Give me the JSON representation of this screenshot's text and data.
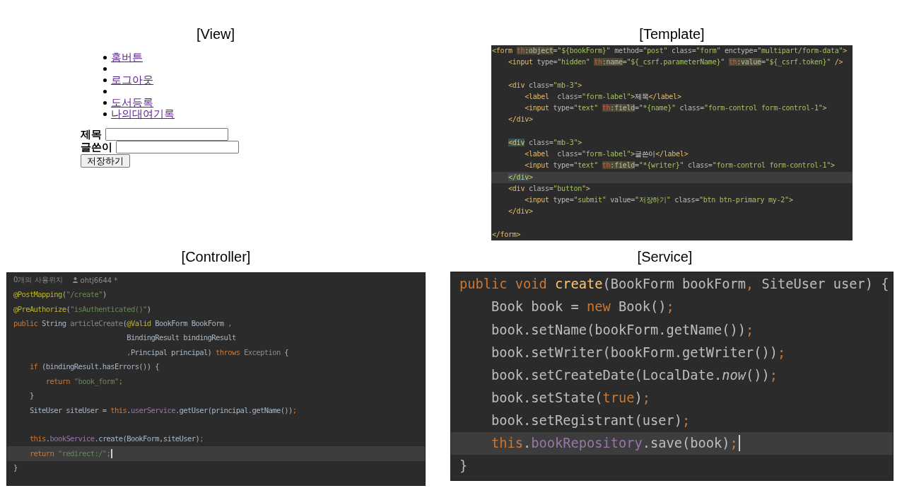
{
  "view": {
    "title": "[View]",
    "nav_items": [
      {
        "kind": "link",
        "label": "홈버튼"
      },
      {
        "kind": "empty"
      },
      {
        "kind": "link",
        "label": "로그아웃"
      },
      {
        "kind": "empty"
      },
      {
        "kind": "link",
        "label": "도서등록"
      },
      {
        "kind": "link",
        "label": "나의대여기록"
      }
    ],
    "form": {
      "fields": [
        {
          "label": "제목"
        },
        {
          "label": "글쓴이"
        }
      ],
      "submit": "저장하기"
    }
  },
  "template": {
    "title": "[Template]",
    "caret": false,
    "lines": [
      {
        "kind": "code",
        "current": false,
        "tokens": [
          {
            "text": "<form ",
            "kind": "tag"
          },
          {
            "text": "th",
            "kind": "th-prefix"
          },
          {
            "text": ":object",
            "kind": "th-attr"
          },
          {
            "text": "=",
            "kind": "attr"
          },
          {
            "text": "\"${bookForm}\"",
            "kind": "value"
          },
          {
            "text": " method=",
            "kind": "attr"
          },
          {
            "text": "\"post\"",
            "kind": "value"
          },
          {
            "text": " class=",
            "kind": "attr"
          },
          {
            "text": "\"form\"",
            "kind": "value"
          },
          {
            "text": " enctype=",
            "kind": "attr"
          },
          {
            "text": "\"multipart/form-data\"",
            "kind": "value"
          },
          {
            "text": ">",
            "kind": "tag"
          }
        ],
        "children": [
          {
            "kind": "code",
            "current": false,
            "tokens": [
              {
                "text": "<input",
                "kind": "tag"
              },
              {
                "text": " type=",
                "kind": "attr"
              },
              {
                "text": "\"hidden\" ",
                "kind": "value"
              },
              {
                "text": "th",
                "kind": "th-prefix"
              },
              {
                "text": ":name",
                "kind": "th-attr"
              },
              {
                "text": "=",
                "kind": "attr"
              },
              {
                "text": "\"${_csrf.parameterName}\" ",
                "kind": "value"
              },
              {
                "text": "th",
                "kind": "th-prefix"
              },
              {
                "text": ":value",
                "kind": "th-attr"
              },
              {
                "text": "=",
                "kind": "attr"
              },
              {
                "text": "\"${_csrf.token}\"",
                "kind": "value"
              },
              {
                "text": " />",
                "kind": "tag"
              }
            ]
          },
          {
            "kind": "blank",
            "current": false
          },
          {
            "kind": "code",
            "current": false,
            "tokens": [
              {
                "text": "<div",
                "kind": "tag"
              },
              {
                "text": " class=",
                "kind": "attr"
              },
              {
                "text": "\"mb-3\"",
                "kind": "value"
              },
              {
                "text": ">",
                "kind": "tag"
              }
            ],
            "children": [
              {
                "kind": "code",
                "current": false,
                "tokens": [
                  {
                    "text": "<label",
                    "kind": "tag"
                  },
                  {
                    "text": "  class=",
                    "kind": "attr"
                  },
                  {
                    "text": "\"form-label\"",
                    "kind": "value"
                  },
                  {
                    "text": ">",
                    "kind": "tag"
                  },
                  {
                    "text": "제목",
                    "kind": "text"
                  },
                  {
                    "text": "</label>",
                    "kind": "tag"
                  }
                ]
              },
              {
                "kind": "code",
                "current": false,
                "tokens": [
                  {
                    "text": "<input",
                    "kind": "tag"
                  },
                  {
                    "text": " type=",
                    "kind": "attr"
                  },
                  {
                    "text": "\"text\" ",
                    "kind": "value"
                  },
                  {
                    "text": "th",
                    "kind": "th-prefix"
                  },
                  {
                    "text": ":field",
                    "kind": "th-attr"
                  },
                  {
                    "text": "=",
                    "kind": "attr"
                  },
                  {
                    "text": "\"*{name}\"",
                    "kind": "value"
                  },
                  {
                    "text": " class=",
                    "kind": "attr"
                  },
                  {
                    "text": "\"form-control form-control-1\"",
                    "kind": "value"
                  },
                  {
                    "text": ">",
                    "kind": "tag"
                  }
                ]
              }
            ]
          },
          {
            "kind": "code",
            "current": false,
            "tokens": [
              {
                "text": "</div>",
                "kind": "tag"
              }
            ]
          },
          {
            "kind": "blank",
            "current": false
          },
          {
            "kind": "code",
            "current": false,
            "tokens": [
              {
                "text": "<div",
                "kind": "tag-matched"
              },
              {
                "text": " class=",
                "kind": "attr"
              },
              {
                "text": "\"mb-3\"",
                "kind": "value"
              },
              {
                "text": ">",
                "kind": "tag"
              }
            ],
            "children": [
              {
                "kind": "code",
                "current": false,
                "tokens": [
                  {
                    "text": "<label",
                    "kind": "tag"
                  },
                  {
                    "text": "  class=",
                    "kind": "attr"
                  },
                  {
                    "text": "\"form-label\"",
                    "kind": "value"
                  },
                  {
                    "text": ">",
                    "kind": "tag"
                  },
                  {
                    "text": "글쓴이",
                    "kind": "text"
                  },
                  {
                    "text": "</label>",
                    "kind": "tag"
                  }
                ]
              },
              {
                "kind": "code",
                "current": false,
                "tokens": [
                  {
                    "text": "<input",
                    "kind": "tag"
                  },
                  {
                    "text": " type=",
                    "kind": "attr"
                  },
                  {
                    "text": "\"text\" ",
                    "kind": "value"
                  },
                  {
                    "text": "th",
                    "kind": "th-prefix"
                  },
                  {
                    "text": ":field",
                    "kind": "th-attr"
                  },
                  {
                    "text": "=",
                    "kind": "attr"
                  },
                  {
                    "text": "\"*{writer}\"",
                    "kind": "value"
                  },
                  {
                    "text": " class=",
                    "kind": "attr"
                  },
                  {
                    "text": "\"form-control form-control-1\"",
                    "kind": "value"
                  },
                  {
                    "text": ">",
                    "kind": "tag"
                  }
                ]
              }
            ]
          },
          {
            "kind": "code",
            "current": true,
            "tokens": [
              {
                "text": "</div",
                "kind": "tag-matched"
              },
              {
                "text": ">",
                "kind": "tag"
              }
            ]
          },
          {
            "kind": "code",
            "current": false,
            "tokens": [
              {
                "text": "<div",
                "kind": "tag"
              },
              {
                "text": " class=",
                "kind": "attr"
              },
              {
                "text": "\"button\"",
                "kind": "value"
              },
              {
                "text": ">",
                "kind": "tag"
              }
            ],
            "children": [
              {
                "kind": "code",
                "current": false,
                "tokens": [
                  {
                    "text": "<input",
                    "kind": "tag"
                  },
                  {
                    "text": " type=",
                    "kind": "attr"
                  },
                  {
                    "text": "\"submit\"",
                    "kind": "value"
                  },
                  {
                    "text": " value=",
                    "kind": "attr"
                  },
                  {
                    "text": "\"저장하기\"",
                    "kind": "value"
                  },
                  {
                    "text": " class=",
                    "kind": "attr"
                  },
                  {
                    "text": "\"btn btn-primary my-2\"",
                    "kind": "value"
                  },
                  {
                    "text": ">",
                    "kind": "tag"
                  }
                ]
              }
            ]
          },
          {
            "kind": "code",
            "current": false,
            "tokens": [
              {
                "text": "</div>",
                "kind": "tag"
              }
            ]
          },
          {
            "kind": "blank",
            "current": false
          }
        ]
      },
      {
        "kind": "code",
        "current": false,
        "tokens": [
          {
            "text": "</form>",
            "kind": "tag"
          }
        ]
      }
    ]
  },
  "controller": {
    "title": "[Controller]",
    "usages": "0개의 사용위치",
    "author": "ohtj6644 *",
    "caret": true,
    "lines": [
      {
        "kind": "code",
        "current": false,
        "tokens": [
          {
            "text": "@PostMapping",
            "kind": "annotation"
          },
          {
            "text": "(",
            "kind": "plain"
          },
          {
            "text": "\"/create\"",
            "kind": "string"
          },
          {
            "text": ")",
            "kind": "plain"
          }
        ]
      },
      {
        "kind": "code",
        "current": false,
        "tokens": [
          {
            "text": "@PreAuthorize",
            "kind": "annotation"
          },
          {
            "text": "(",
            "kind": "plain"
          },
          {
            "text": "\"isAuthenticated()\"",
            "kind": "string"
          },
          {
            "text": ")",
            "kind": "plain"
          }
        ]
      },
      {
        "kind": "code",
        "current": false,
        "tokens": [
          {
            "text": "public ",
            "kind": "keyword"
          },
          {
            "text": "String ",
            "kind": "plain"
          },
          {
            "text": "articleCreate",
            "kind": "muted"
          },
          {
            "text": "(",
            "kind": "plain"
          },
          {
            "text": "@Valid ",
            "kind": "annotation"
          },
          {
            "text": "BookForm BookForm ",
            "kind": "plain"
          },
          {
            "text": ",",
            "kind": "keyword"
          }
        ]
      },
      {
        "kind": "continuation",
        "current": false,
        "tokens": [
          {
            "text": "BindingResult bindingResult",
            "kind": "plain"
          }
        ]
      },
      {
        "kind": "continuation",
        "current": false,
        "tokens": [
          {
            "text": ",",
            "kind": "keyword"
          },
          {
            "text": "Principal principal) ",
            "kind": "plain"
          },
          {
            "text": "throws ",
            "kind": "keyword"
          },
          {
            "text": "Exception ",
            "kind": "muted"
          },
          {
            "text": "{",
            "kind": "plain"
          }
        ],
        "children": [
          {
            "kind": "code",
            "current": false,
            "tokens": [
              {
                "text": "if ",
                "kind": "keyword"
              },
              {
                "text": "(bindingResult.hasErrors()) {",
                "kind": "plain"
              }
            ],
            "children": [
              {
                "kind": "code",
                "current": false,
                "tokens": [
                  {
                    "text": "return ",
                    "kind": "keyword"
                  },
                  {
                    "text": "\"book_form\"",
                    "kind": "string"
                  },
                  {
                    "text": ";",
                    "kind": "keyword"
                  }
                ]
              }
            ]
          },
          {
            "kind": "code",
            "current": false,
            "tokens": [
              {
                "text": "}",
                "kind": "plain"
              }
            ]
          },
          {
            "kind": "code",
            "current": false,
            "tokens": [
              {
                "text": "SiteUser siteUser = ",
                "kind": "plain"
              },
              {
                "text": "this",
                "kind": "keyword"
              },
              {
                "text": ".",
                "kind": "plain"
              },
              {
                "text": "userService",
                "kind": "field"
              },
              {
                "text": ".getUser(principal.getName())",
                "kind": "plain"
              },
              {
                "text": ";",
                "kind": "keyword"
              }
            ]
          },
          {
            "kind": "blank",
            "current": false
          },
          {
            "kind": "code",
            "current": false,
            "tokens": [
              {
                "text": "this",
                "kind": "keyword"
              },
              {
                "text": ".",
                "kind": "plain"
              },
              {
                "text": "bookService",
                "kind": "field"
              },
              {
                "text": ".create(BookForm,siteUser)",
                "kind": "plain"
              },
              {
                "text": ";",
                "kind": "keyword"
              }
            ]
          },
          {
            "kind": "code",
            "current": true,
            "tokens": [
              {
                "text": "return ",
                "kind": "keyword"
              },
              {
                "text": "\"redirect:/\"",
                "kind": "string"
              },
              {
                "text": ";",
                "kind": "keyword"
              }
            ]
          }
        ]
      },
      {
        "kind": "code",
        "current": false,
        "tokens": [
          {
            "text": "}",
            "kind": "plain"
          }
        ]
      }
    ]
  },
  "service": {
    "title": "[Service]",
    "caret": true,
    "lines": [
      {
        "kind": "code",
        "current": false,
        "tokens": [
          {
            "text": "public void ",
            "kind": "keyword"
          },
          {
            "text": "create",
            "kind": "method"
          },
          {
            "text": "(BookForm bookForm",
            "kind": "plain"
          },
          {
            "text": ", ",
            "kind": "keyword"
          },
          {
            "text": "SiteUser user) {",
            "kind": "plain"
          }
        ],
        "children": [
          {
            "kind": "code",
            "current": false,
            "tokens": [
              {
                "text": "Book book = ",
                "kind": "plain"
              },
              {
                "text": "new ",
                "kind": "keyword"
              },
              {
                "text": "Book()",
                "kind": "plain"
              },
              {
                "text": ";",
                "kind": "keyword"
              }
            ]
          },
          {
            "kind": "code",
            "current": false,
            "tokens": [
              {
                "text": "book.setName(bookForm.getName())",
                "kind": "plain"
              },
              {
                "text": ";",
                "kind": "keyword"
              }
            ]
          },
          {
            "kind": "code",
            "current": false,
            "tokens": [
              {
                "text": "book.setWriter(bookForm.getWriter())",
                "kind": "plain"
              },
              {
                "text": ";",
                "kind": "keyword"
              }
            ]
          },
          {
            "kind": "code",
            "current": false,
            "tokens": [
              {
                "text": "book.setCreateDate(LocalDate.",
                "kind": "plain"
              },
              {
                "text": "now",
                "kind": "static-call"
              },
              {
                "text": "())",
                "kind": "plain"
              },
              {
                "text": ";",
                "kind": "keyword"
              }
            ]
          },
          {
            "kind": "code",
            "current": false,
            "tokens": [
              {
                "text": "book.setState(",
                "kind": "plain"
              },
              {
                "text": "true",
                "kind": "keyword"
              },
              {
                "text": ")",
                "kind": "plain"
              },
              {
                "text": ";",
                "kind": "keyword"
              }
            ]
          },
          {
            "kind": "code",
            "current": false,
            "tokens": [
              {
                "text": "book.setRegistrant(user)",
                "kind": "plain"
              },
              {
                "text": ";",
                "kind": "keyword"
              }
            ]
          },
          {
            "kind": "code",
            "current": true,
            "tokens": [
              {
                "text": "this",
                "kind": "keyword"
              },
              {
                "text": ".",
                "kind": "plain"
              },
              {
                "text": "bookRepository",
                "kind": "field"
              },
              {
                "text": ".save(book)",
                "kind": "plain"
              },
              {
                "text": ";",
                "kind": "keyword"
              }
            ]
          }
        ]
      },
      {
        "kind": "code",
        "current": false,
        "tokens": [
          {
            "text": "}",
            "kind": "plain"
          }
        ]
      }
    ]
  }
}
